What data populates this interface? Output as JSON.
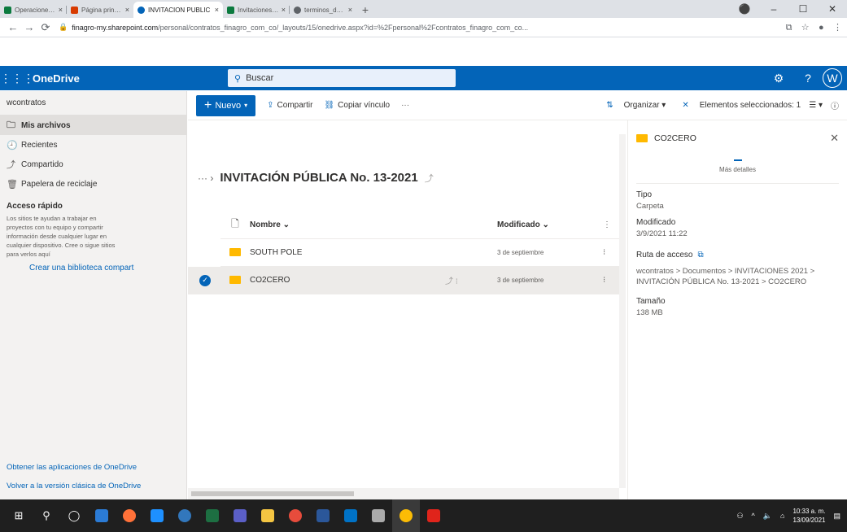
{
  "browser": {
    "tabs": [
      {
        "title": "Operaciones en línea",
        "color": "#0b7a3e"
      },
      {
        "title": "Página principal de",
        "color": "#d83b01"
      },
      {
        "title": "INVITACION PUBLIC",
        "color": "#0364b8",
        "active": true
      },
      {
        "title": "Invitaciones públicas",
        "color": "#0b7a3e"
      },
      {
        "title": "terminos_de_referen",
        "color": "#5f6368"
      }
    ],
    "close_glyph": "×",
    "new_tab": "+",
    "window_controls": [
      "⚫",
      "–",
      "☐",
      "✕"
    ],
    "url_host": "finagro-my.sharepoint.com",
    "url_path": "/personal/contratos_finagro_com_co/_layouts/15/onedrive.aspx?id=%2Fpersonal%2Fcontratos_finagro_com_co..."
  },
  "suite": {
    "app_name": "OneDrive",
    "search_placeholder": "Buscar",
    "avatar": "W"
  },
  "nav": {
    "user": "wcontratos",
    "items": [
      {
        "label": "Mis archivos",
        "icon": "🗀"
      },
      {
        "label": "Recientes",
        "icon": "🕘"
      },
      {
        "label": "Compartido",
        "icon": "⤴"
      },
      {
        "label": "Papelera de reciclaje",
        "icon": "🗑"
      }
    ],
    "quick_access_title": "Acceso rápido",
    "quick_access_desc": "Los sitios te ayudan a trabajar en proyectos con tu equipo y compartir información desde cualquier lugar en cualquier dispositivo. Cree o sigue sitios para verlos aquí",
    "create_library": "Crear una biblioteca compart",
    "get_apps": "Obtener las aplicaciones de OneDrive",
    "classic": "Volver a la versión clásica de OneDrive"
  },
  "cmdbar": {
    "new": "Nuevo",
    "share": "Compartir",
    "copy_link": "Copiar vínculo",
    "more": "···",
    "organize": "Organizar",
    "selected": "Elementos seleccionados: 1"
  },
  "main": {
    "breadcrumb_title": "INVITACIÓN PÚBLICA No. 13-2021",
    "col_name": "Nombre",
    "col_modified": "Modificado",
    "files": [
      {
        "name": "SOUTH POLE",
        "modified": "3 de septiembre",
        "selected": false
      },
      {
        "name": "CO2CERO",
        "modified": "3 de septiembre",
        "selected": true
      }
    ]
  },
  "details": {
    "name": "CO2CERO",
    "more_details": "Más detalles",
    "type_label": "Tipo",
    "type_value": "Carpeta",
    "modified_label": "Modificado",
    "modified_value": "3/9/2021 11:22",
    "path_label": "Ruta de acceso",
    "path_value": "wcontratos > Documentos > INVITACIONES 2021 > INVITACIÓN PÚBLICA No. 13-2021 > CO2CERO",
    "size_label": "Tamaño",
    "size_value": "138 MB"
  },
  "taskbar": {
    "time": "10:33 a. m.",
    "date": "13/09/2021"
  }
}
